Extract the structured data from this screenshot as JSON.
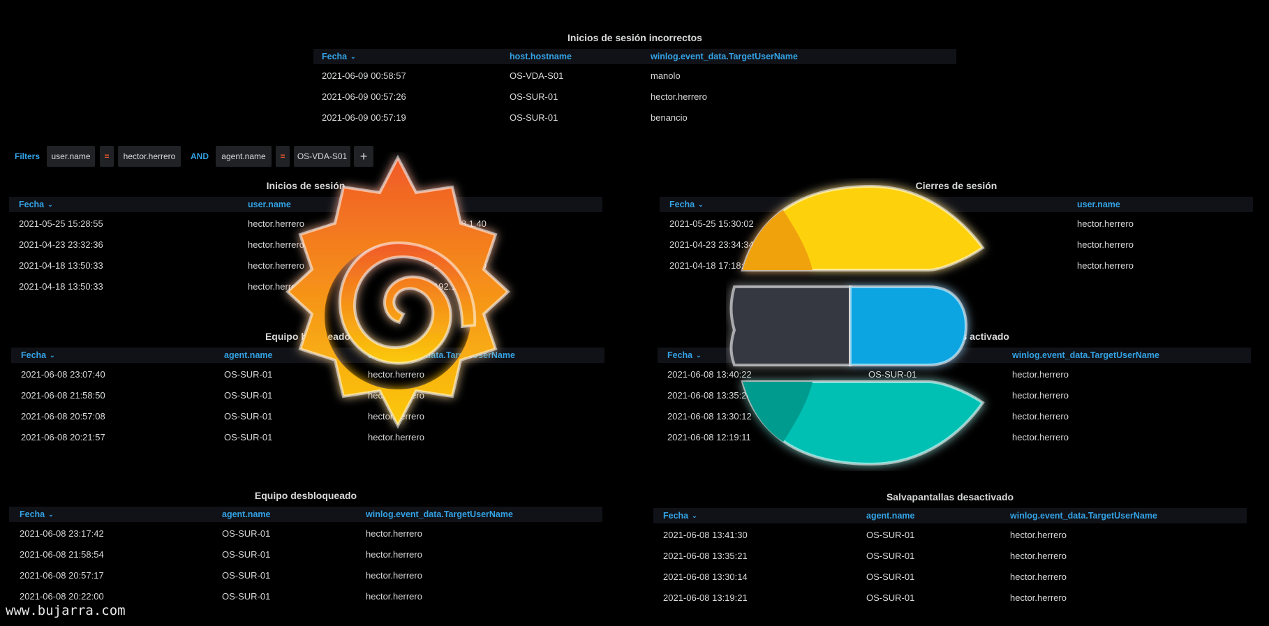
{
  "panels": {
    "failed_logins": {
      "title": "Inicios de sesión incorrectos",
      "columns": [
        "Fecha",
        "host.hostname",
        "winlog.event_data.TargetUserName"
      ],
      "rows": [
        [
          "2021-06-09 00:58:57",
          "OS-VDA-S01",
          "manolo"
        ],
        [
          "2021-06-09 00:57:26",
          "OS-SUR-01",
          "hector.herrero"
        ],
        [
          "2021-06-09 00:57:19",
          "OS-SUR-01",
          "benancio"
        ]
      ]
    },
    "logins": {
      "title": "Inicios de sesión",
      "columns": [
        "Fecha",
        "user.name",
        ""
      ],
      "rows": [
        [
          "2021-05-25 15:28:55",
          "hector.herrero",
          "192.168.1.40"
        ],
        [
          "2021-04-23 23:32:36",
          "hector.herrero",
          "192.168.1.40"
        ],
        [
          "2021-04-18 13:50:33",
          "hector.herrero",
          "192.168.1.40"
        ],
        [
          "2021-04-18 13:50:33",
          "hector.herrero",
          "192.168.1.40"
        ]
      ]
    },
    "logouts": {
      "title": "Cierres de sesión",
      "columns": [
        "Fecha",
        "",
        "user.name"
      ],
      "rows": [
        [
          "2021-05-25 15:30:02",
          "",
          "hector.herrero"
        ],
        [
          "2021-04-23 23:34:34",
          "",
          "hector.herrero"
        ],
        [
          "2021-04-18 17:18:12",
          "",
          "hector.herrero"
        ]
      ]
    },
    "locked": {
      "title": "Equipo bloqueado",
      "columns": [
        "Fecha",
        "agent.name",
        "winlog.event_data.TargetUserName"
      ],
      "rows": [
        [
          "2021-06-08 23:07:40",
          "OS-SUR-01",
          "hector.herrero"
        ],
        [
          "2021-06-08 21:58:50",
          "OS-SUR-01",
          "hector.herrero"
        ],
        [
          "2021-06-08 20:57:08",
          "OS-SUR-01",
          "hector.herrero"
        ],
        [
          "2021-06-08 20:21:57",
          "OS-SUR-01",
          "hector.herrero"
        ]
      ]
    },
    "screensaver_on": {
      "title": "Salvapantallas activado",
      "columns": [
        "Fecha",
        "",
        "winlog.event_data.TargetUserName"
      ],
      "rows": [
        [
          "2021-06-08 13:40:22",
          "OS-SUR-01",
          "hector.herrero"
        ],
        [
          "2021-06-08 13:35:20",
          "",
          "hector.herrero"
        ],
        [
          "2021-06-08 13:30:12",
          "",
          "hector.herrero"
        ],
        [
          "2021-06-08 12:19:11",
          "",
          "hector.herrero"
        ]
      ]
    },
    "unlocked": {
      "title": "Equipo desbloqueado",
      "columns": [
        "Fecha",
        "agent.name",
        "winlog.event_data.TargetUserName"
      ],
      "rows": [
        [
          "2021-06-08 23:17:42",
          "OS-SUR-01",
          "hector.herrero"
        ],
        [
          "2021-06-08 21:58:54",
          "OS-SUR-01",
          "hector.herrero"
        ],
        [
          "2021-06-08 20:57:17",
          "OS-SUR-01",
          "hector.herrero"
        ],
        [
          "2021-06-08 20:22:00",
          "OS-SUR-01",
          "hector.herrero"
        ]
      ]
    },
    "screensaver_off": {
      "title": "Salvapantallas desactivado",
      "columns": [
        "Fecha",
        "agent.name",
        "winlog.event_data.TargetUserName"
      ],
      "rows": [
        [
          "2021-06-08 13:41:30",
          "OS-SUR-01",
          "hector.herrero"
        ],
        [
          "2021-06-08 13:35:21",
          "OS-SUR-01",
          "hector.herrero"
        ],
        [
          "2021-06-08 13:30:14",
          "OS-SUR-01",
          "hector.herrero"
        ],
        [
          "2021-06-08 13:19:21",
          "OS-SUR-01",
          "hector.herrero"
        ]
      ]
    }
  },
  "filters": {
    "label": "Filters",
    "items": [
      {
        "text": "user.name",
        "kind": "key"
      },
      {
        "text": "=",
        "kind": "op"
      },
      {
        "text": "hector.herrero",
        "kind": "key"
      },
      {
        "text": "AND",
        "kind": "cond"
      },
      {
        "text": "agent.name",
        "kind": "key"
      },
      {
        "text": "=",
        "kind": "op"
      },
      {
        "text": "OS-VDA-S01",
        "kind": "key"
      }
    ],
    "add_label": "+"
  },
  "watermark": "www.bujarra.com",
  "colors": {
    "background": "#000000",
    "header_bg": "#111217",
    "header_text": "#33a2e5",
    "text": "#d8d9da",
    "operator": "#e85a2c",
    "grafana_top": "#f05a28",
    "grafana_bottom": "#fbca0a",
    "elastic_yellow": "#fed10a",
    "elastic_blue": "#0ba4e2",
    "elastic_teal": "#00bfb3",
    "elastic_dark": "#343741"
  }
}
